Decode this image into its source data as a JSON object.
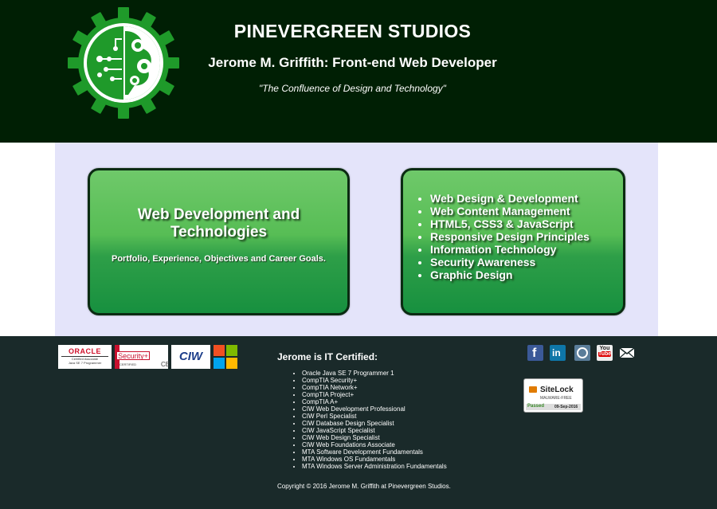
{
  "header": {
    "title": "PINEVERGREEN STUDIOS",
    "subtitle": "Jerome M. Griffith: Front-end Web Developer",
    "tagline": "\"The Confluence of Design and Technology\""
  },
  "panels": {
    "left": {
      "title_line1": "Web Development and",
      "title_line2": "Technologies",
      "description": "Portfolio, Experience, Objectives and Career Goals."
    },
    "right": {
      "skills": [
        "Web Design & Development",
        "Web Content Management",
        "HTML5, CSS3 & JavaScript",
        "Responsive Design Principles",
        "Information Technology",
        "Security Awareness",
        "Graphic Design"
      ]
    }
  },
  "footer": {
    "badges": {
      "oracle": "ORACLE",
      "oracle_sub1": "Certified Associate",
      "oracle_sub2": "Java SE 7 Programmer",
      "security": "Security+",
      "security_sub": "CERTIFIED",
      "security_ce": "CE",
      "ciw": "CIW"
    },
    "cert_title": "Jerome is IT Certified:",
    "certs": [
      "Oracle Java SE 7 Programmer 1",
      "CompTIA Security+",
      "CompTIA Network+",
      "CompTIA Project+",
      "CompTIA A+",
      "CIW Web Development Professional",
      "CIW Perl Specialist",
      "CIW Database Design Specialist",
      "CIW JavaScript Specialist",
      "CIW Web Design Specialist",
      "CIW Web Foundations Associate",
      "MTA Software Development Fundamentals",
      "MTA Windows OS Fundamentals",
      "MTA Windows Server Administration Fundamentals"
    ],
    "copyright": "Copyright © 2016 Jerome M. Griffith at Pinevergreen Studios.",
    "social": {
      "facebook": "f",
      "linkedin": "in",
      "youtube_you": "You",
      "youtube_tube": "Tube"
    },
    "sitelock": {
      "name": "SiteLock",
      "status": "MALWARE-FREE",
      "passed": "Passed",
      "date": "09-Sep-2016"
    }
  },
  "colors": {
    "header_bg": "#001f04",
    "main_bg": "#e4e4fa",
    "panel_green": "#2e9f48",
    "footer_bg": "#1a2a2a"
  }
}
